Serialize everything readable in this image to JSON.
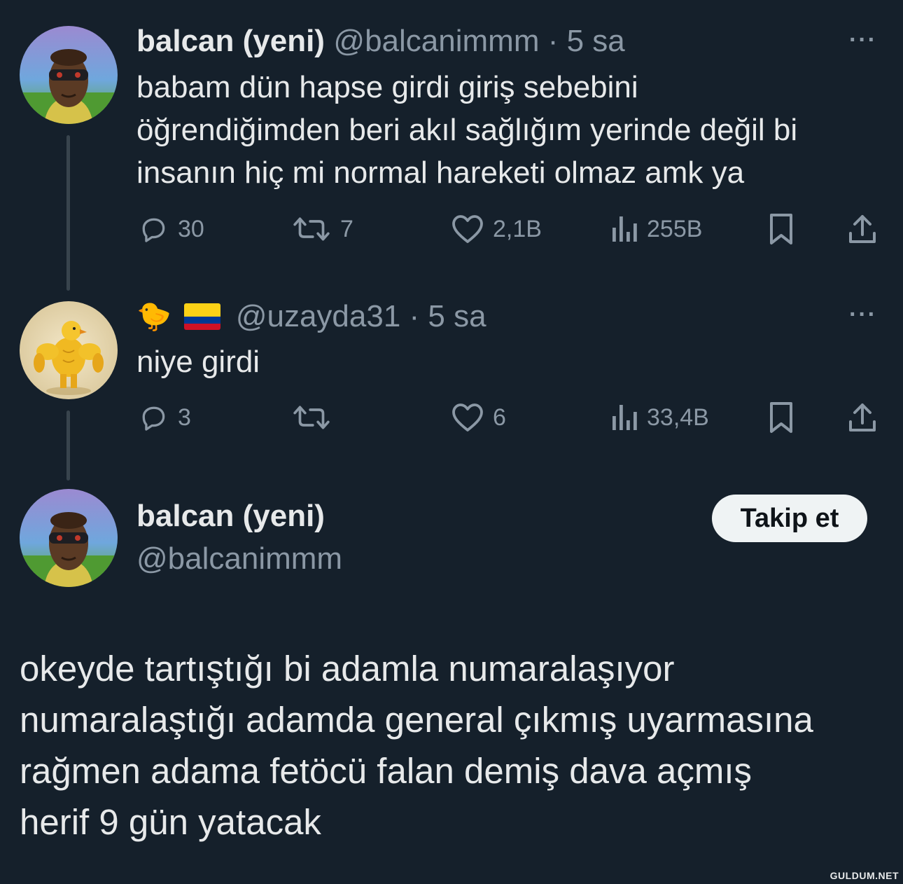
{
  "tweet1": {
    "name": "balcan (yeni)",
    "handle_time": "@balcanimmm · 5 sa",
    "text_lines": [
      "babam dün hapse girdi giriş sebebini",
      "öğrendiğimden beri akıl sağlığım yerinde değil bi",
      "insanın hiç mi normal hareketi olmaz amk ya"
    ],
    "more": "···",
    "replies": "30",
    "retweets": "7",
    "likes": "2,1B",
    "views": "255B"
  },
  "tweet2": {
    "name_emoji": "🐤",
    "handle_time": "@uzayda31 · 5 sa",
    "text": "niye girdi",
    "more": "···",
    "replies": "3",
    "retweets": "",
    "likes": "6",
    "views": "33,4B"
  },
  "tweet3": {
    "name": "balcan (yeni)",
    "handle": "@balcanimmm",
    "follow_label": "Takip et",
    "text_lines": [
      "okeyde tartıştığı bi adamla numaralaşıyor",
      "numaralaştığı adamda general çıkmış uyarmasına",
      "rağmen adama fetöcü falan demiş dava açmış",
      "herif 9 gün yatacak"
    ]
  },
  "watermark": "GULDUM.NET",
  "colors": {
    "background": "#15202b",
    "text": "#e7e9ea",
    "muted": "#8b98a5",
    "thread_line": "#38444d",
    "follow_bg": "#eff3f4"
  }
}
